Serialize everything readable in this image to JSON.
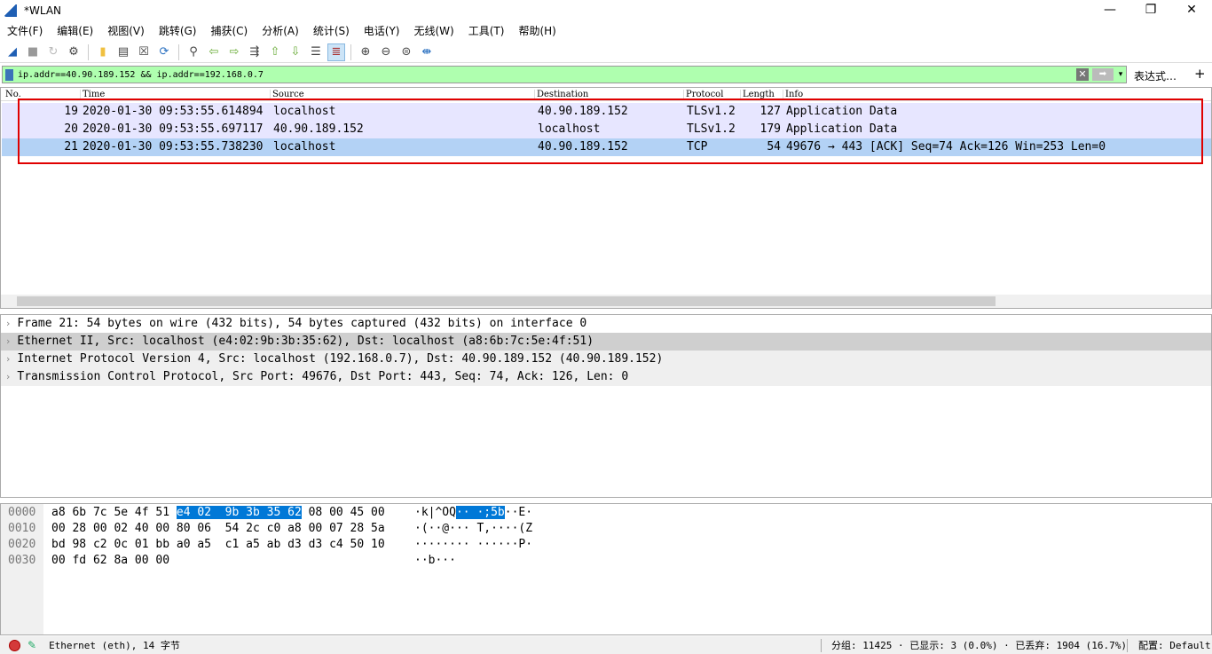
{
  "window": {
    "title": "*WLAN",
    "min": "—",
    "max": "❐",
    "close": "✕"
  },
  "menu": [
    "文件(F)",
    "编辑(E)",
    "视图(V)",
    "跳转(G)",
    "捕获(C)",
    "分析(A)",
    "统计(S)",
    "电话(Y)",
    "无线(W)",
    "工具(T)",
    "帮助(H)"
  ],
  "filter": {
    "value": "ip.addr==40.90.189.152 && ip.addr==192.168.0.7",
    "expression_label": "表达式…",
    "plus": "+",
    "clear": "✕",
    "apply": "➡",
    "dropdown": "▾"
  },
  "columns": [
    "No.",
    "Time",
    "Source",
    "Destination",
    "Protocol",
    "Length",
    "Info"
  ],
  "packets": [
    {
      "no": "19",
      "time": "2020-01-30 09:53:55.614894",
      "src": "localhost",
      "dst": "40.90.189.152",
      "proto": "TLSv1.2",
      "len": "127",
      "info": "Application Data"
    },
    {
      "no": "20",
      "time": "2020-01-30 09:53:55.697117",
      "src": "40.90.189.152",
      "dst": "localhost",
      "proto": "TLSv1.2",
      "len": "179",
      "info": "Application Data"
    },
    {
      "no": "21",
      "time": "2020-01-30 09:53:55.738230",
      "src": "localhost",
      "dst": "40.90.189.152",
      "proto": "TCP",
      "len": "54",
      "info": "49676 → 443 [ACK] Seq=74 Ack=126 Win=253 Len=0"
    }
  ],
  "details": [
    "Frame 21: 54 bytes on wire (432 bits), 54 bytes captured (432 bits) on interface 0",
    "Ethernet II, Src: localhost (e4:02:9b:3b:35:62), Dst: localhost (a8:6b:7c:5e:4f:51)",
    "Internet Protocol Version 4, Src: localhost (192.168.0.7), Dst: 40.90.189.152 (40.90.189.152)",
    "Transmission Control Protocol, Src Port: 49676, Dst Port: 443, Seq: 74, Ack: 126, Len: 0"
  ],
  "hex": [
    {
      "off": "0000",
      "a": "a8 6b 7c 5e 4f 51 ",
      "hl": "e4 02  9b 3b 35 62",
      "b": " 08 00 45 00",
      "asc_a": "·k|^OQ",
      "asc_hl": "·· ·;5b",
      "asc_b": "··E·"
    },
    {
      "off": "0010",
      "a": "00 28 00 02 40 00 80 06  54 2c c0 a8 00 07 28 5a",
      "hl": "",
      "b": "",
      "asc_a": "·(··@··· T,····(Z",
      "asc_hl": "",
      "asc_b": ""
    },
    {
      "off": "0020",
      "a": "bd 98 c2 0c 01 bb a0 a5  c1 a5 ab d3 d3 c4 50 10",
      "hl": "",
      "b": "",
      "asc_a": "········ ······P·",
      "asc_hl": "",
      "asc_b": ""
    },
    {
      "off": "0030",
      "a": "00 fd 62 8a 00 00",
      "hl": "",
      "b": "",
      "asc_a": "··b···",
      "asc_hl": "",
      "asc_b": ""
    }
  ],
  "status": {
    "field": "Ethernet (eth), 14 字节",
    "stats": "分组: 11425 · 已显示: 3 (0.0%) · 已丢弃: 1904 (16.7%)",
    "profile": "配置: Default"
  },
  "colors": {
    "filter_bg": "#afffaf",
    "row_bg": "#e7e6ff",
    "row_selected": "#b3d2f5",
    "annotation_box": "#e00000",
    "hex_highlight": "#0078d7"
  }
}
